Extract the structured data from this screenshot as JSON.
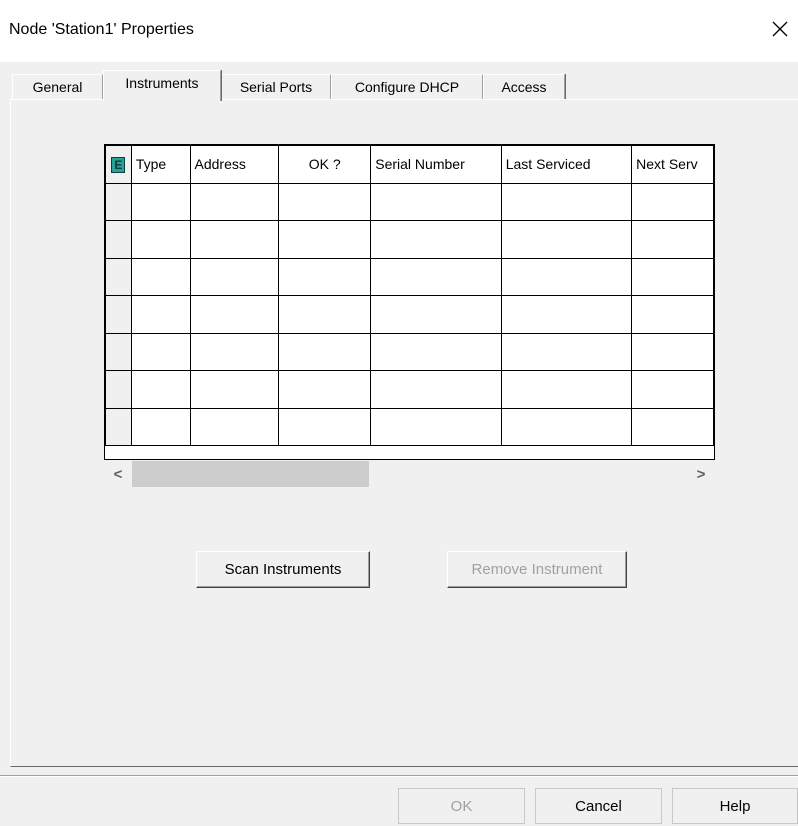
{
  "window": {
    "title": "Node 'Station1' Properties",
    "close_glyph": "✕"
  },
  "tabs": [
    {
      "label": "General",
      "active": false
    },
    {
      "label": "Instruments",
      "active": true
    },
    {
      "label": "Serial Ports",
      "active": false
    },
    {
      "label": "Configure DHCP",
      "active": false
    },
    {
      "label": "Access",
      "active": false
    }
  ],
  "grid": {
    "corner_icon": "E",
    "columns": [
      "Type",
      "Address",
      "OK ?",
      "Serial Number",
      "Last Serviced",
      "Next Serv"
    ],
    "rows": [
      [
        "",
        "",
        "",
        "",
        "",
        ""
      ],
      [
        "",
        "",
        "",
        "",
        "",
        ""
      ],
      [
        "",
        "",
        "",
        "",
        "",
        ""
      ],
      [
        "",
        "",
        "",
        "",
        "",
        ""
      ],
      [
        "",
        "",
        "",
        "",
        "",
        ""
      ],
      [
        "",
        "",
        "",
        "",
        "",
        ""
      ],
      [
        "",
        "",
        "",
        "",
        "",
        ""
      ]
    ]
  },
  "scrollbar": {
    "left_arrow": "<",
    "right_arrow": ">"
  },
  "actions": {
    "scan_label": "Scan Instruments",
    "remove_label": "Remove Instrument"
  },
  "footer": {
    "ok_label": "OK",
    "cancel_label": "Cancel",
    "help_label": "Help"
  },
  "colors": {
    "corner_icon_bg": "#2aa197",
    "corner_icon_fg": "#0b3f3b"
  }
}
